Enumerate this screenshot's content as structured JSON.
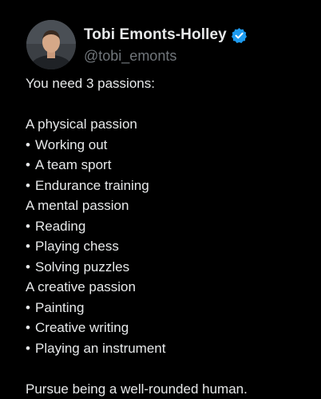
{
  "author": {
    "display_name": "Tobi Emonts-Holley",
    "handle": "@tobi_emonts",
    "verified_badge_color": "#1d9bf0"
  },
  "post": {
    "intro": "You need 3 passions:",
    "sections": [
      {
        "heading": "A physical passion",
        "items": [
          "Working out",
          "A team sport",
          "Endurance training"
        ]
      },
      {
        "heading": "A mental passion",
        "items": [
          "Reading",
          "Playing chess",
          "Solving puzzles"
        ]
      },
      {
        "heading": "A creative passion",
        "items": [
          "Painting",
          "Creative writing",
          "Playing an instrument"
        ]
      }
    ],
    "bullet": "•",
    "closing": "Pursue being a well-rounded human."
  },
  "colors": {
    "background": "#000000",
    "primary_text": "#e7e9ea",
    "secondary_text": "#71767b"
  }
}
